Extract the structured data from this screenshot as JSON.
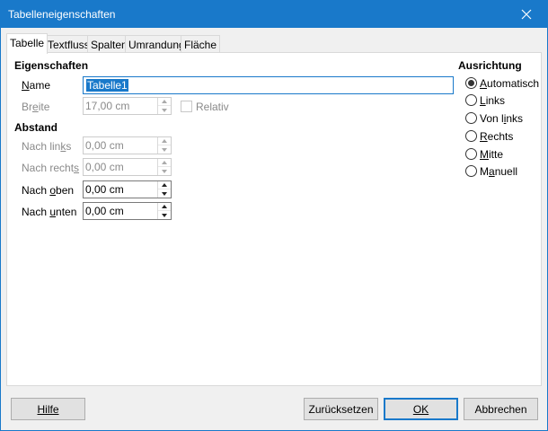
{
  "window": {
    "title": "Tabelleneigenschaften"
  },
  "tabs": [
    "Tabelle",
    "Textfluss",
    "Spalten",
    "Umrandung",
    "Fläche"
  ],
  "properties": {
    "heading": "Eigenschaften",
    "name_label": "Name",
    "name_value": "Tabelle1",
    "width_label": "Breite",
    "width_value": "17,00 cm",
    "relative_label": "Relativ"
  },
  "spacing": {
    "heading": "Abstand",
    "left_label": "Nach links",
    "left_value": "0,00 cm",
    "right_label": "Nach rechts",
    "right_value": "0,00 cm",
    "top_label": "Nach oben",
    "top_value": "0,00 cm",
    "bottom_label": "Nach unten",
    "bottom_value": "0,00 cm"
  },
  "alignment": {
    "heading": "Ausrichtung",
    "options": [
      "Automatisch",
      "Links",
      "Von links",
      "Rechts",
      "Mitte",
      "Manuell"
    ],
    "selected": "Automatisch"
  },
  "buttons": {
    "help": "Hilfe",
    "reset": "Zurücksetzen",
    "ok": "OK",
    "cancel": "Abbrechen"
  }
}
